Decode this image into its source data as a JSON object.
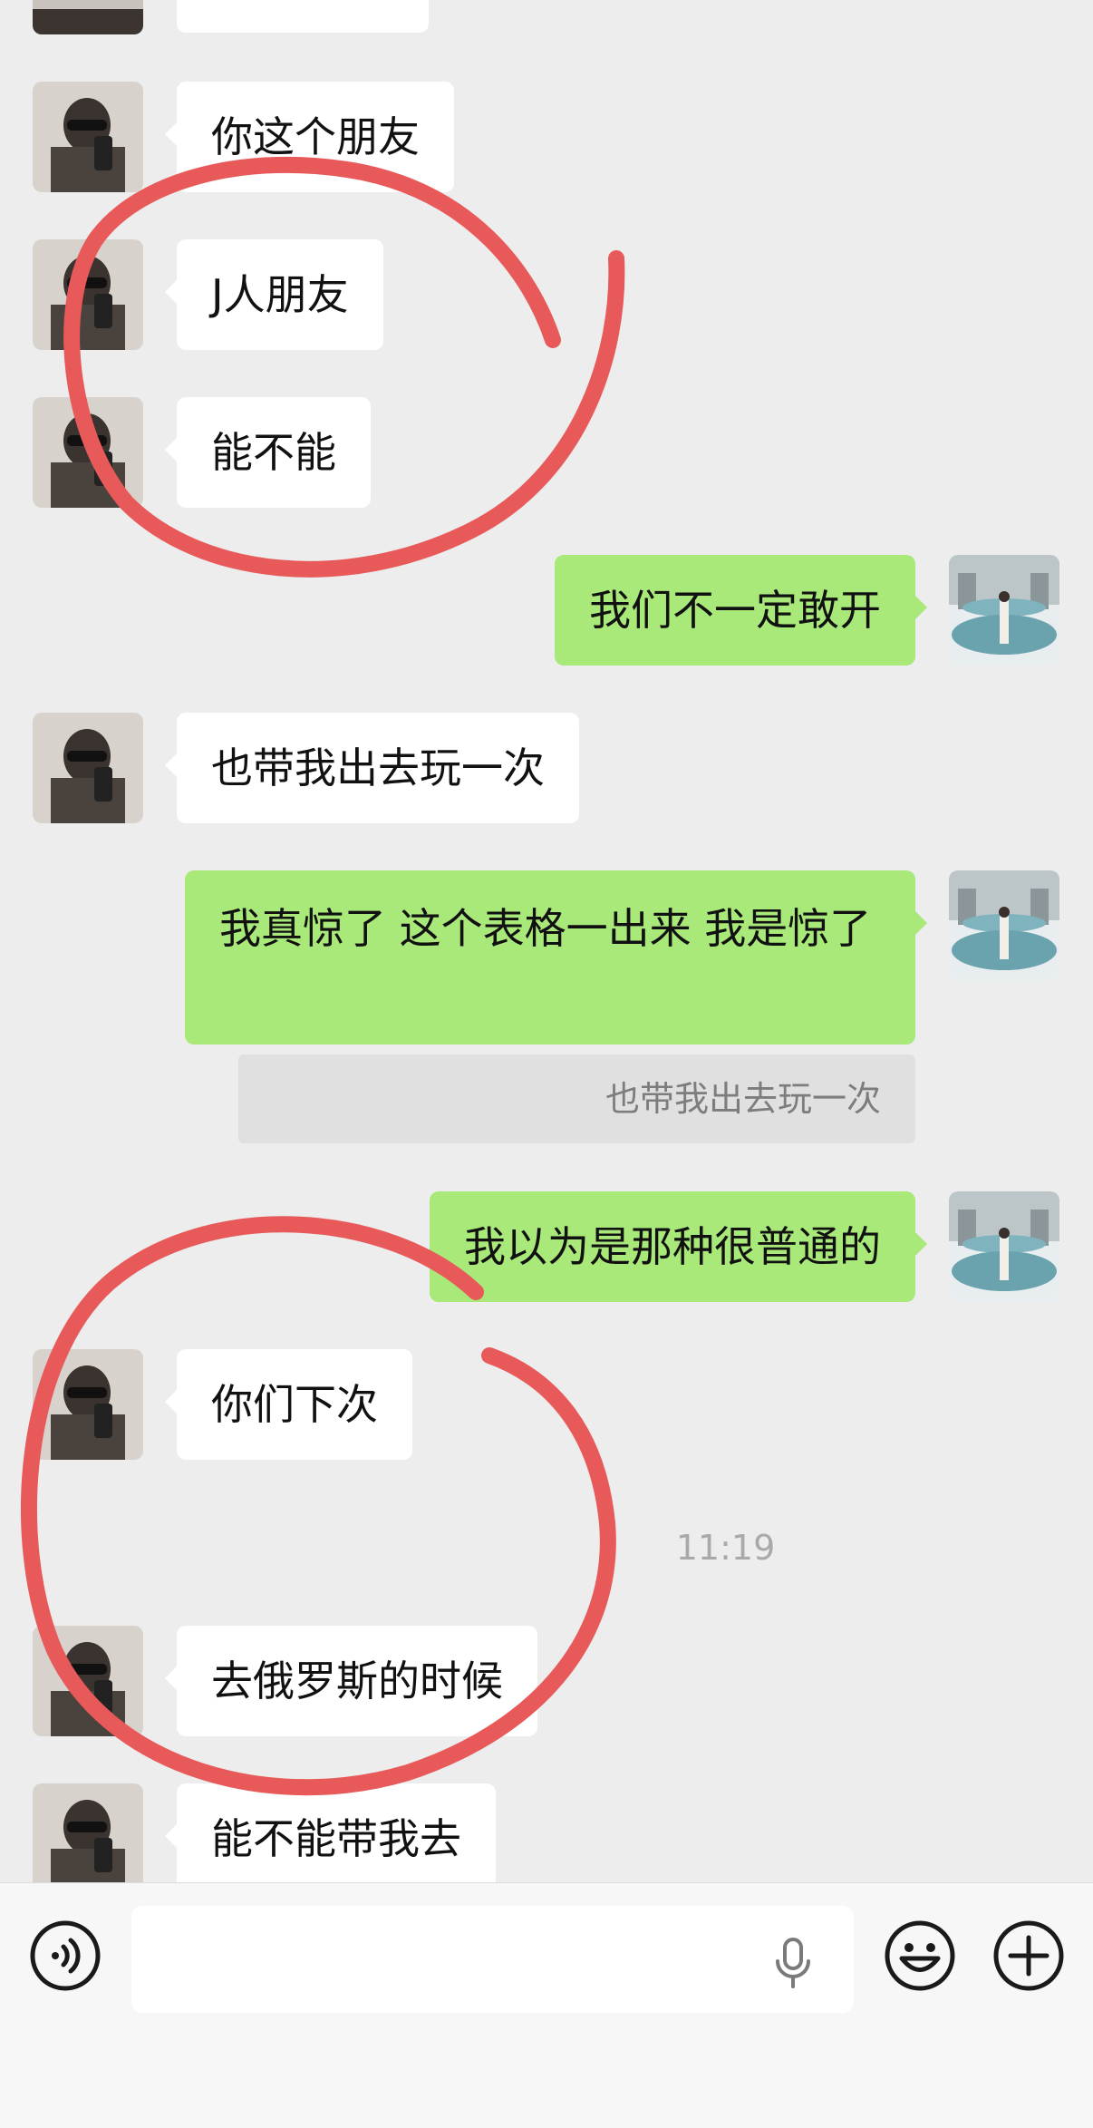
{
  "messages": [
    {
      "from": "other",
      "text": "你这个朋友"
    },
    {
      "from": "other",
      "text": "J人朋友"
    },
    {
      "from": "other",
      "text": "能不能"
    },
    {
      "from": "self",
      "text": "我们不一定敢开"
    },
    {
      "from": "other",
      "text": "也带我出去玩一次"
    },
    {
      "from": "self",
      "text": "我真惊了 这个表格一出来 我是惊了",
      "quote": "也带我出去玩一次"
    },
    {
      "from": "self",
      "text": "我以为是那种很普通的"
    },
    {
      "from": "other",
      "text": "你们下次"
    },
    {
      "from": "other",
      "text": "去俄罗斯的时候"
    },
    {
      "from": "other",
      "text": "能不能带我去"
    }
  ],
  "timestamp": "11:19",
  "input": {
    "value": "",
    "placeholder": ""
  },
  "icons": {
    "voice": "voice-mode-icon",
    "mic": "microphone-icon",
    "emoji": "emoji-icon",
    "more": "plus-icon"
  },
  "colors": {
    "background": "#ededed",
    "self_bubble": "#a9e97a",
    "other_bubble": "#ffffff",
    "annotation": "#e85a5a"
  }
}
